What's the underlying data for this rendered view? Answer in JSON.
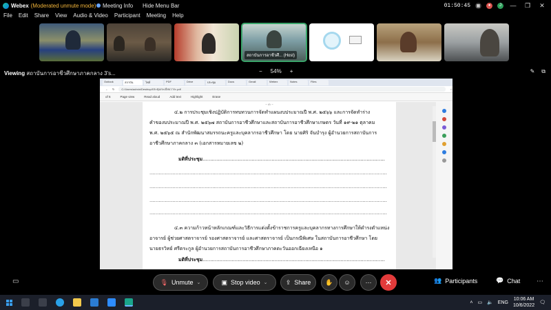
{
  "titlebar": {
    "app_name": "Webex",
    "mode": "(Moderated unmute mode)",
    "meeting_info": "Meeting Info",
    "hide_menu": "Hide Menu Bar",
    "timer": "01:50:45"
  },
  "menubar": [
    "File",
    "Edit",
    "Share",
    "View",
    "Audio & Video",
    "Participant",
    "Meeting",
    "Help"
  ],
  "participants": [
    {
      "label": ""
    },
    {
      "label": ""
    },
    {
      "label": ""
    },
    {
      "label": "สถาบันการอาชีวศึ... (Host)"
    },
    {
      "label": ""
    },
    {
      "label": ""
    },
    {
      "label": ""
    }
  ],
  "viewing": {
    "prefix": "Viewing",
    "title": "สถาบันการอาชีวศึกษาภาคกลาง 3's...",
    "zoom_out": "−",
    "zoom": "54%",
    "zoom_in": "+"
  },
  "browser": {
    "tabs": [
      "Outlook",
      "สถาบัน",
      "ไฟล์",
      "PDF",
      "Drive",
      "ประชุม",
      "Docs",
      "Gmail",
      "Webex",
      "Notes",
      "Files"
    ],
    "url": "C:/Users/admin/Desktop/ประชุม/ระเบียบวาระ.pdf",
    "page_counter": "of 6",
    "tool_labels": [
      "Page view",
      "Read aloud",
      "Add text",
      "Highlight",
      "Erase"
    ]
  },
  "document": {
    "page_number": "– ๓ –",
    "item1_line1": "๔.๒ การประชุมเชิงปฏิบัติการทบทวนการจัดทำแผนงบประมาณปี พ.ศ. ๒๕๖๖ และการจัดทำร่าง",
    "item1_line2": "คำของบประมาณปี พ.ศ. ๒๕๖๗ สถาบันการอาชีวศึกษาและสถาบันการอาชีวศึกษาเกษตร วันที่ ๑๙-๒๑ ตุลาคม",
    "item1_line3": "พ.ศ. ๒๕๖๕ ณ สำนักพัฒนาสมรรถนะครูและบุคลากรอาชีวศึกษา โดย นายศิริ จันบำรุง ผู้อำนวยการสถาบันการ",
    "item1_line4": "อาชีวศึกษาภาคกลาง ๓ (เอกสารหมายเลข ๒)",
    "resolution_label": "มติที่ประชุม",
    "dots": "........................................................................................................................................................................",
    "item2_line1": "๔.๓ ความก้าวหน้าหลักเกณฑ์และวิธีการแต่งตั้งข้าราชการครูและบุคลากรทางการศึกษาให้ดำรงตำแหน่ง",
    "item2_line2": "อาจารย์ ผู้ช่วยศาสตราจารย์ รองศาสตราจารย์ และศาสตราจารย์ เป็นกรณีพิเศษ ในสถาบันการอาชีวศึกษา โดย",
    "item2_line3": "นายธรวิทย์ ศรีตระกูล ผู้อำนวยการสถาบันการอาชีวศึกษาภาคตะวันออกเฉียงเหนือ ๑",
    "resolution_label2": "มติที่ประชุม"
  },
  "controls": {
    "unmute": "Unmute",
    "stop_video": "Stop video",
    "share": "Share",
    "participants": "Participants",
    "chat": "Chat"
  },
  "taskbar": {
    "lang": "ENG",
    "time": "10:06 AM",
    "date": "10/6/2022"
  },
  "colors": {
    "mode_text": "#f3b53a",
    "leave_button": "#e23b3b",
    "active_speaker": "#3aa56a"
  }
}
